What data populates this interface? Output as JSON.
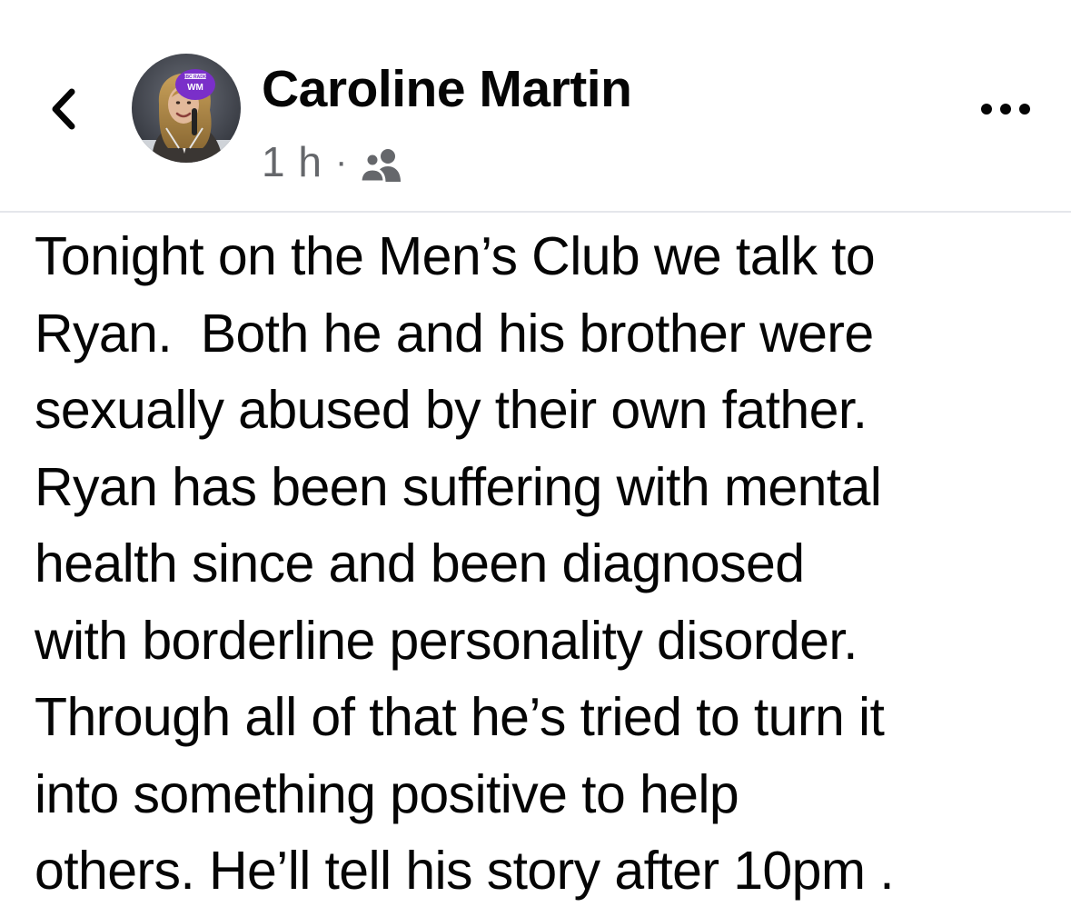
{
  "post": {
    "author_name": "Caroline Martin",
    "timestamp": "1 h",
    "separator": "·",
    "audience_icon": "friends-icon",
    "avatar_badge_text": "WM",
    "avatar_badge_small": "BBC RADIO",
    "body_text": "Tonight on the Men’s Club we talk to\nRyan.  Both he and his brother were\nsexually abused by their own father.\nRyan has been suffering with mental\nhealth since and been diagnosed\nwith borderline personality disorder.\nThrough all of that he’s tried to turn it\ninto something positive to help\nothers. He’ll tell his story after 10pm ."
  },
  "nav": {
    "back_icon": "chevron-left-icon",
    "more_icon": "more-horizontal-icon"
  },
  "colors": {
    "text": "#050505",
    "secondary_text": "#65676b",
    "divider": "#e4e6eb",
    "badge_purple": "#7a2fc9"
  }
}
